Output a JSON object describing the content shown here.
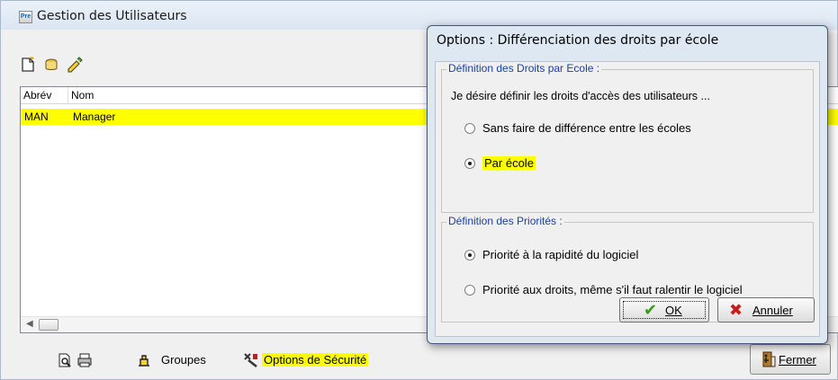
{
  "main": {
    "title": "Gestion des Utilisateurs",
    "app_icon_text": "Pre",
    "toolbar": {
      "new_icon": "new-document-icon",
      "open_icon": "open-icon",
      "edit_icon": "edit-icon"
    },
    "list": {
      "columns": [
        "Abrév",
        "Nom"
      ],
      "rows": [
        {
          "abrev": "MAN",
          "nom": "Manager",
          "selected": true
        }
      ]
    },
    "bottom": {
      "preview_icon": "print-preview-icon",
      "print_icon": "printer-icon",
      "groups_label": "Groupes",
      "security_label": "Options de Sécurité",
      "close_label": "Fermer"
    }
  },
  "dialog": {
    "title": "Options : Différenciation des droits par école",
    "group1": {
      "legend": "Définition des Droits par Ecole :",
      "question": "Je désire définir les droits d'accès des utilisateurs ...",
      "options": [
        {
          "label": "Sans faire de différence entre les écoles",
          "checked": false
        },
        {
          "label": "Par école",
          "checked": true
        }
      ]
    },
    "group2": {
      "legend": "Définition des Priorités :",
      "options": [
        {
          "label": "Priorité à la rapidité du logiciel",
          "checked": true
        },
        {
          "label": "Priorité aux droits, même s'il faut ralentir le logiciel",
          "checked": false
        }
      ]
    },
    "ok_label": "OK",
    "cancel_label": "Annuler"
  },
  "colors": {
    "highlight": "#ffff00",
    "legend_text": "#1a3f9c",
    "ok_check": "#3a9a1a",
    "cancel_x": "#cc1a1a"
  }
}
